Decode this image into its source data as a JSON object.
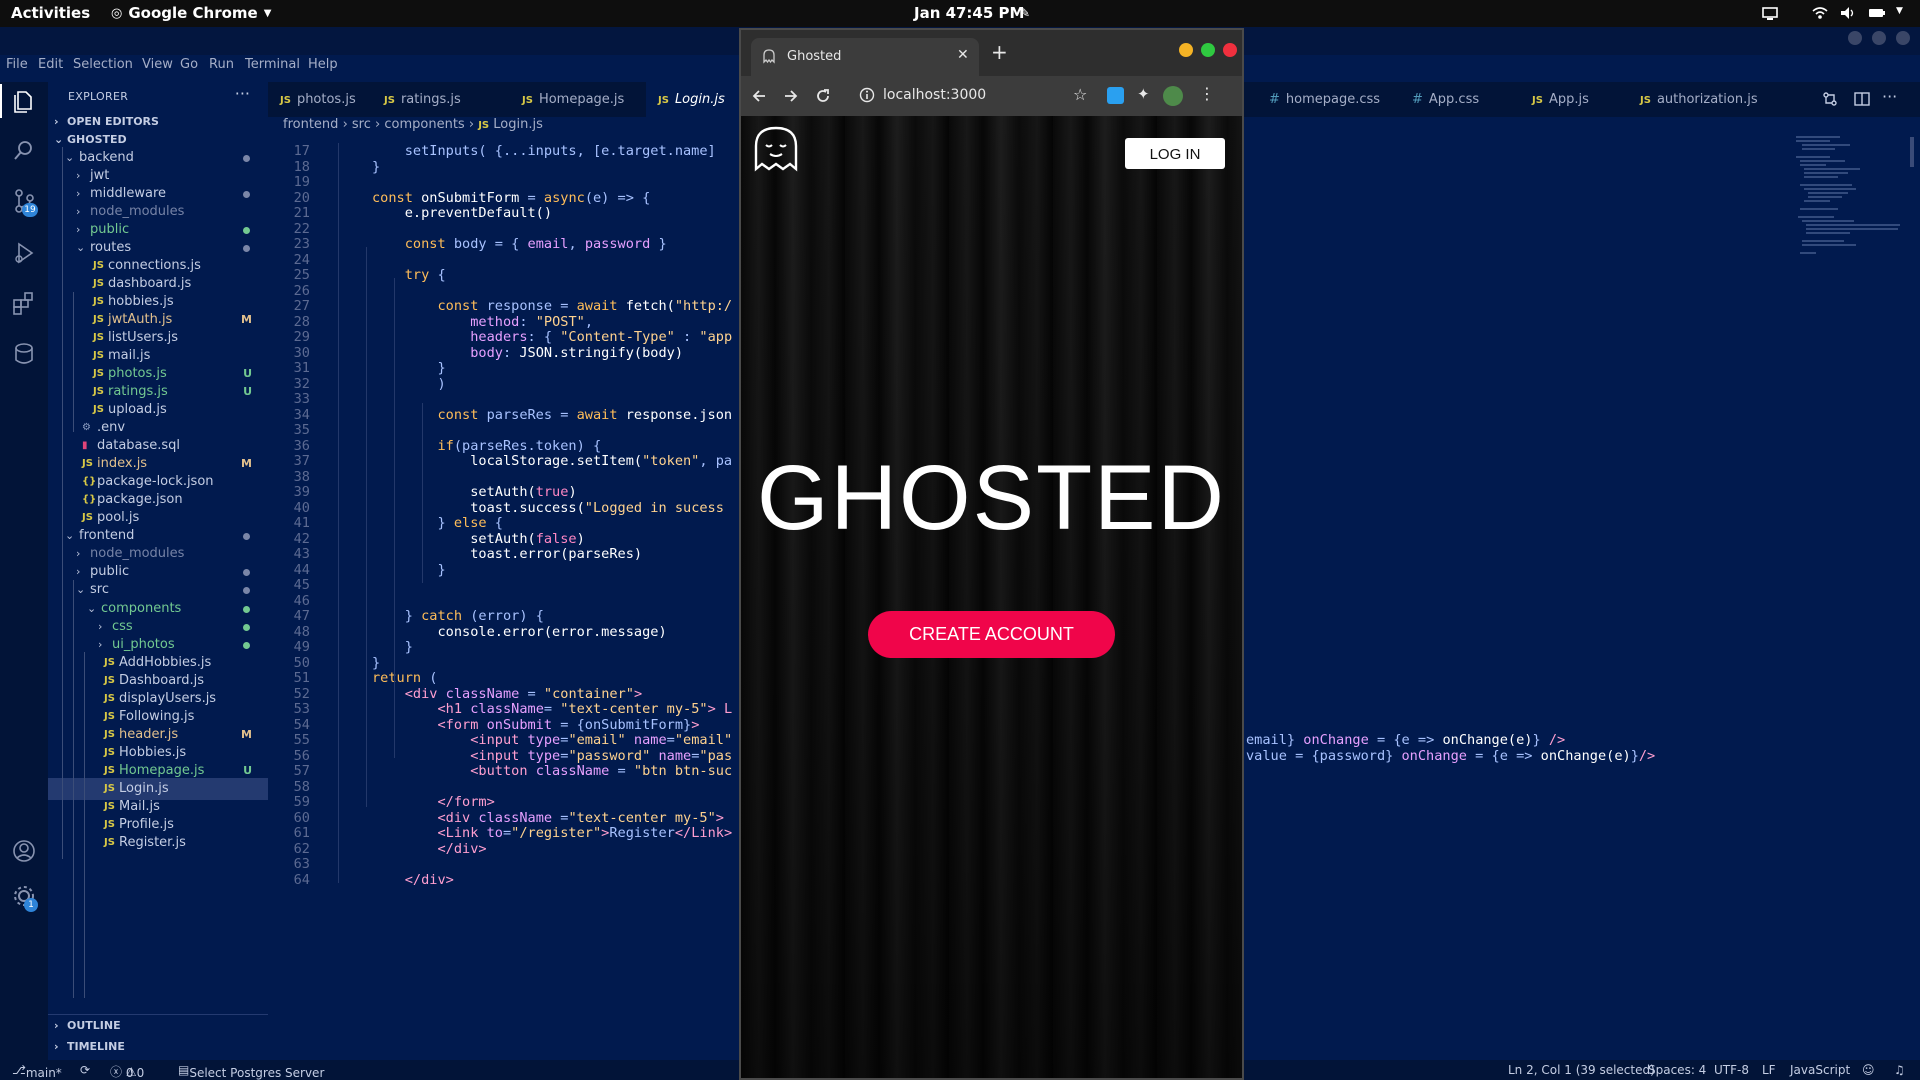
{
  "topbar": {
    "activities": "Activities",
    "app_name": "Google Chrome",
    "date": "Jan 4",
    "time": "7:45 PM"
  },
  "menu": [
    "File",
    "Edit",
    "Selection",
    "View",
    "Go",
    "Run",
    "Terminal",
    "Help"
  ],
  "explorer": {
    "title": "EXPLORER",
    "open_editors": "OPEN EDITORS",
    "root": "GHOSTED",
    "outline": "OUTLINE",
    "timeline": "TIMELINE",
    "items": [
      {
        "name": "backend",
        "kind": "folder-open",
        "depth": 1,
        "dot": true
      },
      {
        "name": "jwt",
        "kind": "folder",
        "depth": 2
      },
      {
        "name": "middleware",
        "kind": "folder",
        "depth": 2,
        "dot": true
      },
      {
        "name": "node_modules",
        "kind": "folder",
        "depth": 2,
        "dim": true
      },
      {
        "name": "public",
        "kind": "folder",
        "depth": 2,
        "color": "#73c991",
        "dot": true,
        "dotColor": "#73c991"
      },
      {
        "name": "routes",
        "kind": "folder-open",
        "depth": 2,
        "dot": true
      },
      {
        "name": "connections.js",
        "kind": "js",
        "depth": 3
      },
      {
        "name": "dashboard.js",
        "kind": "js",
        "depth": 3
      },
      {
        "name": "hobbies.js",
        "kind": "js",
        "depth": 3
      },
      {
        "name": "jwtAuth.js",
        "kind": "js",
        "depth": 3,
        "badge": "M",
        "color": "#e2c08d"
      },
      {
        "name": "listUsers.js",
        "kind": "js",
        "depth": 3
      },
      {
        "name": "mail.js",
        "kind": "js",
        "depth": 3
      },
      {
        "name": "photos.js",
        "kind": "js",
        "depth": 3,
        "badge": "U",
        "color": "#73c991"
      },
      {
        "name": "ratings.js",
        "kind": "js",
        "depth": 3,
        "badge": "U",
        "color": "#73c991"
      },
      {
        "name": "upload.js",
        "kind": "js",
        "depth": 3
      },
      {
        "name": ".env",
        "kind": "gear",
        "depth": 2
      },
      {
        "name": "database.sql",
        "kind": "db",
        "depth": 2
      },
      {
        "name": "index.js",
        "kind": "js",
        "depth": 2,
        "badge": "M",
        "color": "#e2c08d"
      },
      {
        "name": "package-lock.json",
        "kind": "json",
        "depth": 2
      },
      {
        "name": "package.json",
        "kind": "json",
        "depth": 2
      },
      {
        "name": "pool.js",
        "kind": "js",
        "depth": 2
      },
      {
        "name": "frontend",
        "kind": "folder-open",
        "depth": 1,
        "dot": true
      },
      {
        "name": "node_modules",
        "kind": "folder",
        "depth": 2,
        "dim": true
      },
      {
        "name": "public",
        "kind": "folder",
        "depth": 2,
        "dot": true
      },
      {
        "name": "src",
        "kind": "folder-open",
        "depth": 2,
        "dot": true
      },
      {
        "name": "components",
        "kind": "folder-open",
        "depth": 3,
        "color": "#73c991",
        "dot": true,
        "dotColor": "#73c991"
      },
      {
        "name": "css",
        "kind": "folder",
        "depth": 4,
        "color": "#73c991",
        "dot": true,
        "dotColor": "#73c991"
      },
      {
        "name": "ui_photos",
        "kind": "folder",
        "depth": 4,
        "color": "#73c991",
        "dot": true,
        "dotColor": "#73c991"
      },
      {
        "name": "AddHobbies.js",
        "kind": "js",
        "depth": 4
      },
      {
        "name": "Dashboard.js",
        "kind": "js",
        "depth": 4
      },
      {
        "name": "displayUsers.js",
        "kind": "js",
        "depth": 4
      },
      {
        "name": "Following.js",
        "kind": "js",
        "depth": 4
      },
      {
        "name": "header.js",
        "kind": "js",
        "depth": 4,
        "badge": "M",
        "color": "#e2c08d"
      },
      {
        "name": "Hobbies.js",
        "kind": "js",
        "depth": 4
      },
      {
        "name": "Homepage.js",
        "kind": "js",
        "depth": 4,
        "badge": "U",
        "color": "#73c991"
      },
      {
        "name": "Login.js",
        "kind": "js",
        "depth": 4,
        "selected": true
      },
      {
        "name": "Mail.js",
        "kind": "js",
        "depth": 4
      },
      {
        "name": "Profile.js",
        "kind": "js",
        "depth": 4
      },
      {
        "name": "Register.js",
        "kind": "js",
        "depth": 4
      }
    ]
  },
  "tabs": [
    {
      "label": "photos.js",
      "icon": "JS"
    },
    {
      "label": "ratings.js",
      "icon": "JS"
    },
    {
      "label": "Homepage.js",
      "icon": "JS"
    },
    {
      "label": "Login.js",
      "icon": "JS",
      "active": true
    },
    {
      "label": "homepage.css",
      "icon": "#"
    },
    {
      "label": "App.css",
      "icon": "#"
    },
    {
      "label": "App.js",
      "icon": "JS"
    },
    {
      "label": "authorization.js",
      "icon": "JS"
    }
  ],
  "breadcrumb": [
    "frontend",
    "src",
    "components",
    "Login.js"
  ],
  "code": {
    "first_line": 17,
    "lines": [
      [
        [
          "p",
          "    setInputs( {...inputs, [e.target.name] "
        ]
      ],
      [
        [
          "p",
          "}"
        ]
      ],
      [],
      [
        [
          "k",
          "const "
        ],
        [
          "f",
          "onSubmitForm"
        ],
        [
          "p",
          " = "
        ],
        [
          "k",
          "async"
        ],
        [
          "p",
          "(e) => {"
        ]
      ],
      [
        [
          "f",
          "    e.preventDefault()"
        ]
      ],
      [],
      [
        [
          "k",
          "    const "
        ],
        [
          "p",
          "body = { "
        ],
        [
          "v",
          "email"
        ],
        [
          "p",
          ", "
        ],
        [
          "v",
          "password"
        ],
        [
          "p",
          " }"
        ]
      ],
      [],
      [
        [
          "k",
          "    try "
        ],
        [
          "p",
          "{"
        ]
      ],
      [],
      [
        [
          "k",
          "        const "
        ],
        [
          "p",
          "response = "
        ],
        [
          "k",
          "await "
        ],
        [
          "f",
          "fetch("
        ],
        [
          "s",
          "\"http:/"
        ]
      ],
      [
        [
          "v",
          "            method"
        ],
        [
          "p",
          ": "
        ],
        [
          "s",
          "\"POST\""
        ],
        [
          "p",
          ","
        ]
      ],
      [
        [
          "v",
          "            headers"
        ],
        [
          "p",
          ": { "
        ],
        [
          "s",
          "\"Content-Type\""
        ],
        [
          "p",
          " : "
        ],
        [
          "s",
          "\"app"
        ]
      ],
      [
        [
          "v",
          "            body"
        ],
        [
          "p",
          ": "
        ],
        [
          "f",
          "JSON.stringify(body)"
        ]
      ],
      [
        [
          "p",
          "        }"
        ]
      ],
      [
        [
          "p",
          "        )"
        ]
      ],
      [],
      [
        [
          "k",
          "        const "
        ],
        [
          "p",
          "parseRes = "
        ],
        [
          "k",
          "await "
        ],
        [
          "f",
          "response.json"
        ]
      ],
      [],
      [
        [
          "k",
          "        if"
        ],
        [
          "p",
          "(parseRes.token) {"
        ]
      ],
      [
        [
          "f",
          "            localStorage.setItem("
        ],
        [
          "s",
          "\"token\""
        ],
        [
          "p",
          ", pa"
        ]
      ],
      [],
      [
        [
          "f",
          "            setAuth("
        ],
        [
          "o",
          "true"
        ],
        [
          "f",
          ")"
        ]
      ],
      [
        [
          "f",
          "            toast.success("
        ],
        [
          "s",
          "\"Logged in sucess"
        ]
      ],
      [
        [
          "p",
          "        } "
        ],
        [
          "k",
          "else "
        ],
        [
          "p",
          "{"
        ]
      ],
      [
        [
          "f",
          "            setAuth("
        ],
        [
          "o",
          "false"
        ],
        [
          "f",
          ")"
        ]
      ],
      [
        [
          "f",
          "            toast.error(parseRes)"
        ]
      ],
      [
        [
          "p",
          "        }"
        ]
      ],
      [],
      [],
      [
        [
          "p",
          "    } "
        ],
        [
          "k",
          "catch "
        ],
        [
          "p",
          "(error) {"
        ]
      ],
      [
        [
          "f",
          "        console.error(error.message)"
        ]
      ],
      [
        [
          "p",
          "    }"
        ]
      ],
      [
        [
          "p",
          "}"
        ]
      ],
      [
        [
          "k",
          "return "
        ],
        [
          "p",
          "("
        ]
      ],
      [
        [
          "tg",
          "    <div "
        ],
        [
          "v",
          "className"
        ],
        [
          "p",
          " = "
        ],
        [
          "s",
          "\"container\""
        ],
        [
          "tg",
          ">"
        ]
      ],
      [
        [
          "tg",
          "        <h1 "
        ],
        [
          "v",
          "className"
        ],
        [
          "p",
          "= "
        ],
        [
          "s",
          "\"text-center my-5\""
        ],
        [
          "tg",
          "> L"
        ]
      ],
      [
        [
          "tg",
          "        <form "
        ],
        [
          "v",
          "onSubmit"
        ],
        [
          "p",
          " = {onSubmitForm}"
        ],
        [
          "tg",
          ">"
        ]
      ],
      [
        [
          "tg",
          "            <input "
        ],
        [
          "v",
          "type"
        ],
        [
          "p",
          "="
        ],
        [
          "s",
          "\"email\""
        ],
        [
          "v",
          " name"
        ],
        [
          "p",
          "="
        ],
        [
          "s",
          "\"email\""
        ]
      ],
      [
        [
          "tg",
          "            <input "
        ],
        [
          "v",
          "type"
        ],
        [
          "p",
          "="
        ],
        [
          "s",
          "\"password\""
        ],
        [
          "v",
          " name"
        ],
        [
          "p",
          "="
        ],
        [
          "s",
          "\"pas"
        ]
      ],
      [
        [
          "tg",
          "            <button "
        ],
        [
          "v",
          "className"
        ],
        [
          "p",
          " = "
        ],
        [
          "s",
          "\"btn btn-suc"
        ]
      ],
      [],
      [
        [
          "tg",
          "        </form>"
        ]
      ],
      [
        [
          "tg",
          "        <div "
        ],
        [
          "v",
          "className"
        ],
        [
          "p",
          " ="
        ],
        [
          "s",
          "\"text-center my-5\""
        ],
        [
          "tg",
          "> "
        ]
      ],
      [
        [
          "tg",
          "        <Link "
        ],
        [
          "v",
          "to"
        ],
        [
          "p",
          "="
        ],
        [
          "s",
          "\"/register\""
        ],
        [
          "tg",
          ">"
        ],
        [
          "p",
          "Register"
        ],
        [
          "tg",
          "</Link>"
        ]
      ],
      [
        [
          "tg",
          "        </div>"
        ]
      ],
      [],
      [
        [
          "tg",
          "    </div>"
        ]
      ]
    ],
    "right_fragments": [
      {
        "line": 55,
        "parts": [
          [
            "p",
            "email} "
          ],
          [
            "v",
            "onChange"
          ],
          [
            "p",
            " = {e => "
          ],
          [
            "f",
            "onChange(e)"
          ],
          [
            "p",
            "} "
          ],
          [
            "tg",
            "/>"
          ]
        ]
      },
      {
        "line": 56,
        "parts": [
          [
            "p",
            "value = {password} "
          ],
          [
            "v",
            "onChange"
          ],
          [
            "p",
            " = {e => "
          ],
          [
            "f",
            "onChange(e)"
          ],
          [
            "p",
            "}"
          ],
          [
            "tg",
            "/>"
          ]
        ]
      }
    ]
  },
  "status": {
    "branch": "main*",
    "problems": "0",
    "warnings": "0",
    "postgres": "Select Postgres Server",
    "position": "Ln 2, Col 1 (39 selected)",
    "spaces": "Spaces: 4",
    "encoding": "UTF-8",
    "eol": "LF",
    "language": "JavaScript"
  },
  "activity_badges": {
    "scm": "19",
    "settings": "1"
  },
  "chrome": {
    "tab_title": "Ghosted",
    "url": "localhost:3000",
    "page": {
      "login": "LOG IN",
      "title": "GHOSTED",
      "create": "CREATE ACCOUNT"
    },
    "accent": "#f0054a"
  }
}
